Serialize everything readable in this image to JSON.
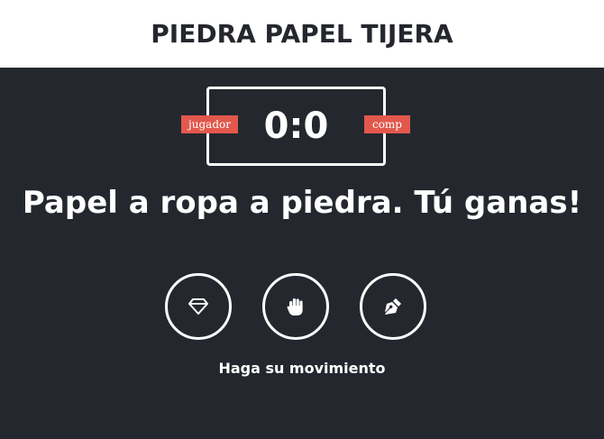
{
  "header": {
    "title": "PIEDRA PAPEL TIJERA"
  },
  "scoreboard": {
    "score": "0:0",
    "user_label": "jugador",
    "comp_label": "comp"
  },
  "result": {
    "message": "Papel a ropa a piedra. Tú ganas!"
  },
  "choices": [
    {
      "id": "rock",
      "icon": "gem-icon"
    },
    {
      "id": "paper",
      "icon": "hand-icon"
    },
    {
      "id": "scissors",
      "icon": "pen-nib-icon"
    }
  ],
  "action": {
    "message": "Haga su movimiento"
  },
  "colors": {
    "header_bg": "#ffffff",
    "body_bg": "#25272e",
    "badge": "#e2584d",
    "text": "#ffffff"
  }
}
